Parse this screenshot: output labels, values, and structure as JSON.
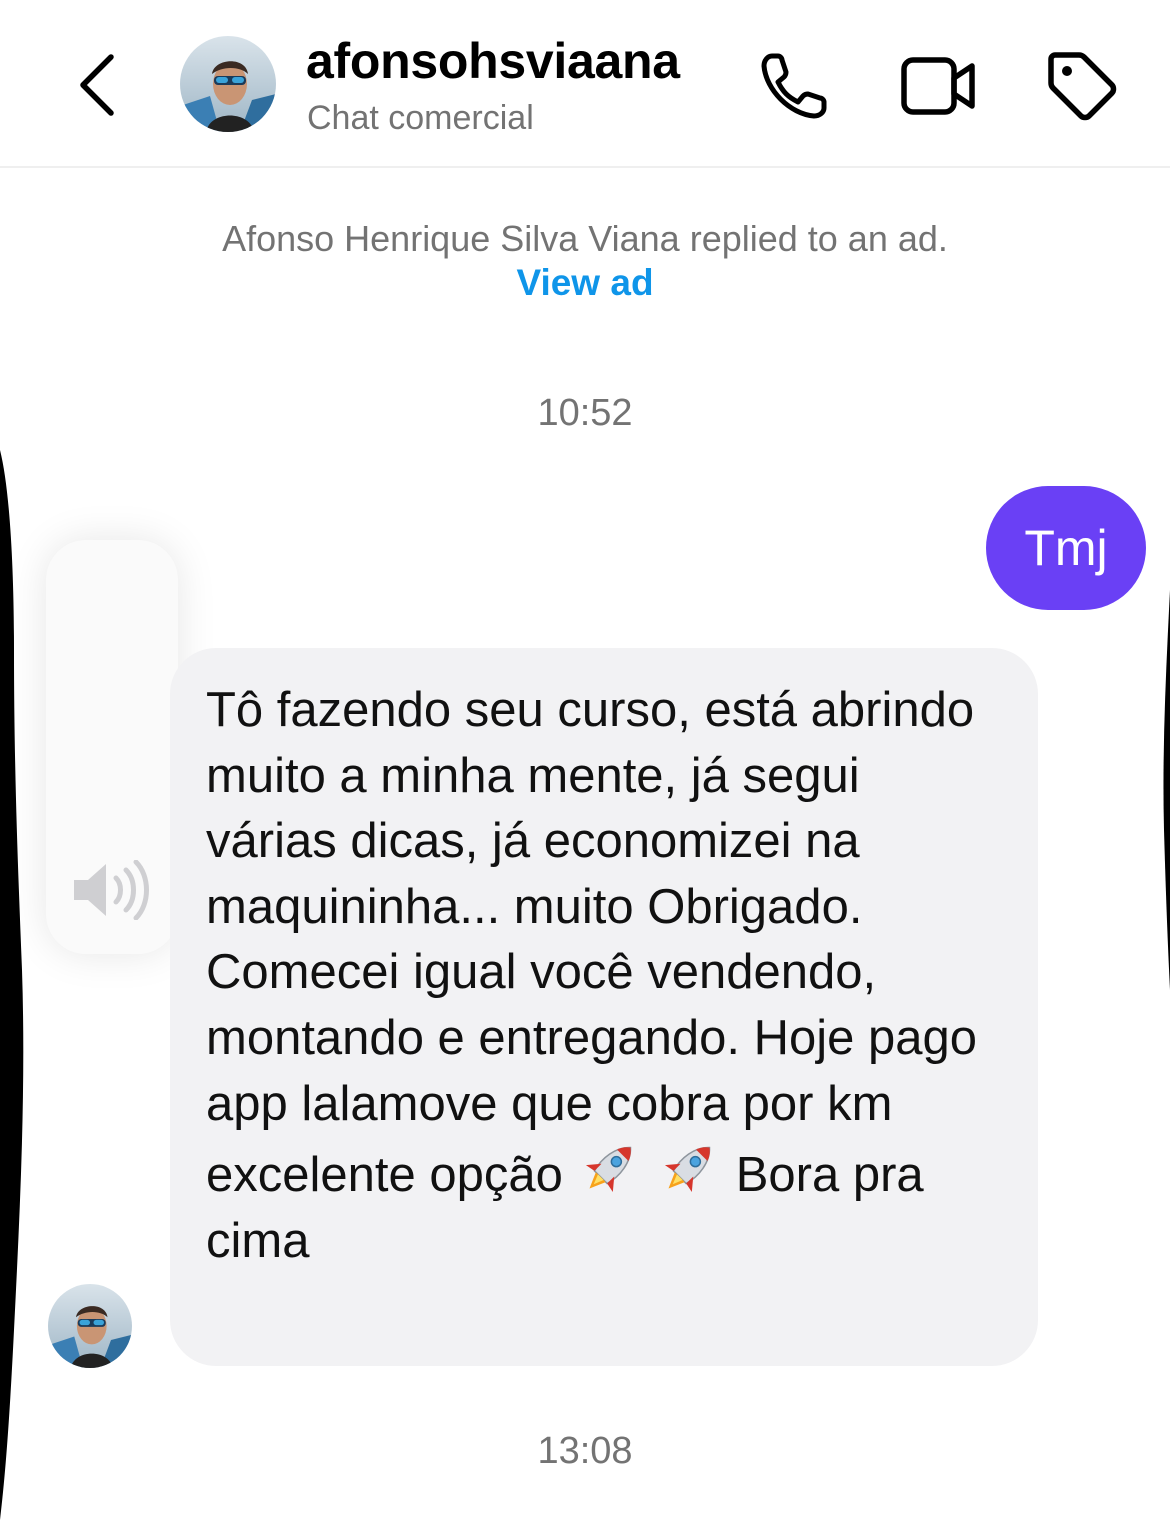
{
  "header": {
    "contact_name": "afonsohsviaana",
    "contact_subtitle": "Chat comercial",
    "icons": [
      "chevron-left-icon",
      "phone-icon",
      "video-camera-icon",
      "tag-icon"
    ]
  },
  "thread": {
    "ad_notice": "Afonso Henrique Silva Viana replied to an ad.",
    "view_ad_label": "View ad",
    "timestamp_1": "10:52",
    "outgoing_message": "Tmj",
    "incoming_message": {
      "part1": "Tô fazendo seu curso, está abrindo muito a minha mente, já segui várias dicas, já economizei na maquininha... muito Obrigado. Comecei igual você vendendo, montando e entregando. Hoje pago app lalamove que cobra por km excelente opção ",
      "part2": " Bora pra cima"
    },
    "timestamp_2": "13:08"
  },
  "overlay": {
    "type": "volume-hud",
    "icon": "speaker-icon"
  },
  "colors": {
    "outgoing_bubble": "#6a40f5",
    "incoming_bubble": "#f2f2f4",
    "link": "#0f95e9",
    "secondary_text": "#737373"
  }
}
